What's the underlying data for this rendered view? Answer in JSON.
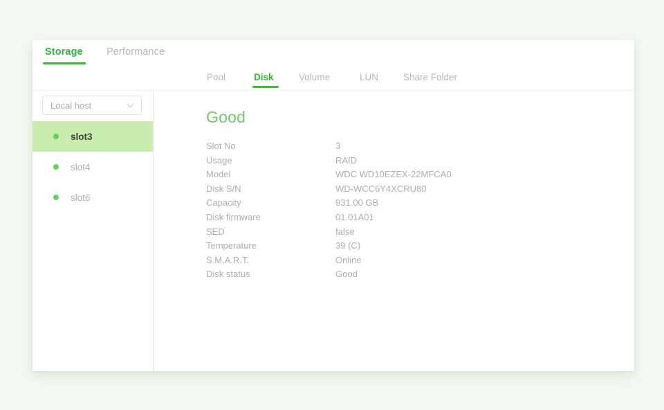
{
  "theme": {
    "page_background": "#f3f8f1",
    "card_background": "#ffffff",
    "accent_green": "#35b630",
    "accent_green_dark": "#2eb33f",
    "status_green": "#72c86a",
    "selection_green": "#c9edad",
    "dot_green": "#62d362",
    "muted_text": "#aab0ac"
  },
  "primary_tabs": [
    {
      "label": "Storage",
      "active": true
    },
    {
      "label": "Performance",
      "active": false
    }
  ],
  "secondary_tabs": [
    {
      "label": "Pool",
      "active": false
    },
    {
      "label": "Disk",
      "active": true
    },
    {
      "label": "Volume",
      "active": false
    },
    {
      "label": "LUN",
      "active": false
    },
    {
      "label": "Share Folder",
      "active": false
    }
  ],
  "sidebar": {
    "host_select": {
      "value": "Local host",
      "icon": "chevron-down-icon"
    },
    "slots": [
      {
        "label": "slot3",
        "selected": true,
        "status_icon": "status-dot-icon"
      },
      {
        "label": "slot4",
        "selected": false,
        "status_icon": "status-dot-icon"
      },
      {
        "label": "slot6",
        "selected": false,
        "status_icon": "status-dot-icon"
      }
    ]
  },
  "detail": {
    "status_heading": "Good",
    "rows": [
      {
        "label": "Slot No",
        "value": "3"
      },
      {
        "label": "Usage",
        "value": "RAID"
      },
      {
        "label": "Model",
        "value": "WDC WD10EZEX-22MFCA0"
      },
      {
        "label": "Disk S/N",
        "value": "WD-WCC6Y4XCRU80"
      },
      {
        "label": "Capacity",
        "value": "931.00 GB"
      },
      {
        "label": "Disk firmware",
        "value": "01.01A01"
      },
      {
        "label": "SED",
        "value": "false"
      },
      {
        "label": "Temperature",
        "value": "39 (C)"
      },
      {
        "label": "S.M.A.R.T.",
        "value": "Online"
      },
      {
        "label": "Disk status",
        "value": "Good"
      }
    ]
  }
}
